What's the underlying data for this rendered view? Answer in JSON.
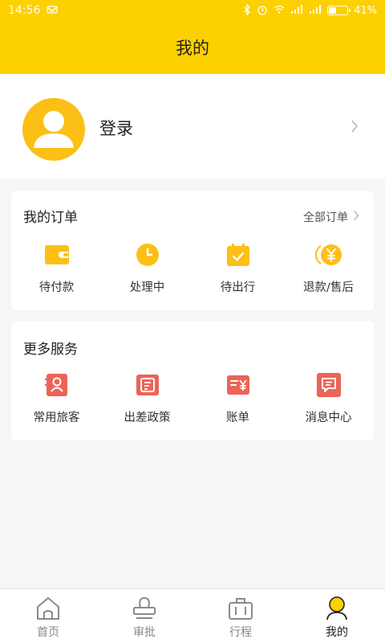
{
  "status_bar": {
    "time": "14:56",
    "battery": "41%"
  },
  "header": {
    "title": "我的"
  },
  "profile": {
    "login_label": "登录"
  },
  "orders": {
    "title": "我的订单",
    "all_label": "全部订单",
    "items": [
      {
        "label": "待付款",
        "icon": "wallet-icon"
      },
      {
        "label": "处理中",
        "icon": "clock-icon"
      },
      {
        "label": "待出行",
        "icon": "calendar-check-icon"
      },
      {
        "label": "退款/售后",
        "icon": "refund-icon"
      }
    ]
  },
  "services": {
    "title": "更多服务",
    "items": [
      {
        "label": "常用旅客",
        "icon": "traveler-icon"
      },
      {
        "label": "出差政策",
        "icon": "policy-icon"
      },
      {
        "label": "账单",
        "icon": "bill-icon"
      },
      {
        "label": "消息中心",
        "icon": "message-icon"
      }
    ]
  },
  "tabbar": {
    "items": [
      {
        "label": "首页",
        "icon": "home-icon"
      },
      {
        "label": "审批",
        "icon": "approval-icon"
      },
      {
        "label": "行程",
        "icon": "suitcase-icon"
      },
      {
        "label": "我的",
        "icon": "user-icon",
        "active": true
      }
    ]
  },
  "colors": {
    "brand_yellow": "#fdd000",
    "order_icon": "#fbbf16",
    "service_icon": "#ec6457",
    "active_tab_icon": "#fdd000"
  }
}
